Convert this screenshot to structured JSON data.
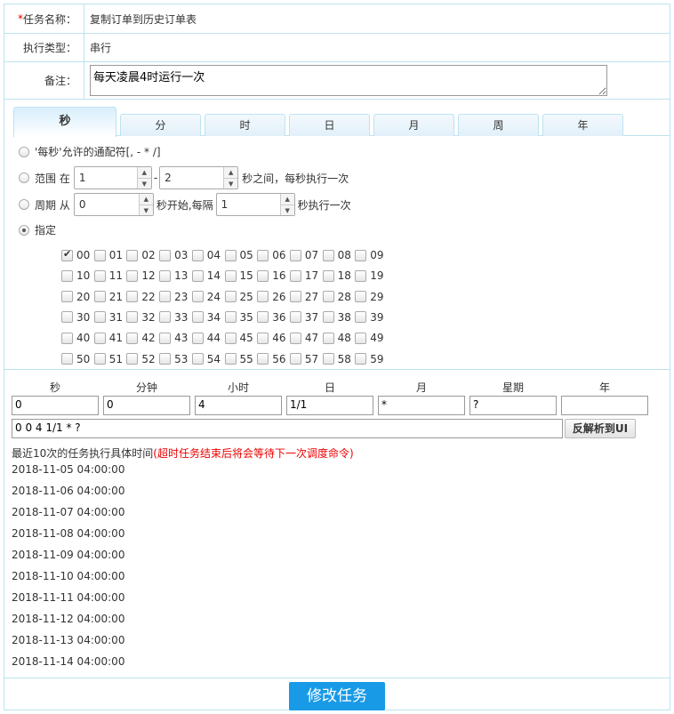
{
  "form": {
    "task_name_required_mark": "*",
    "task_name_label": "任务名称：",
    "task_name_value": "复制订单到历史订单表",
    "exec_type_label": "执行类型：",
    "exec_type_value": "串行",
    "note_label": "备注：",
    "note_value": "每天凌晨4时运行一次"
  },
  "tabs": [
    "秒",
    "分",
    "时",
    "日",
    "月",
    "周",
    "年"
  ],
  "active_tab": "秒",
  "seconds": {
    "opt_every": "'每秒'允许的通配符[, - * /]",
    "opt_range_prefix": "范围 在",
    "range_from": "1",
    "range_dash": "-",
    "range_to": "2",
    "opt_range_suffix": "秒之间，每秒执行一次",
    "opt_cycle_prefix": "周期 从",
    "cycle_start": "0",
    "cycle_mid": "秒开始,每隔",
    "cycle_step": "1",
    "cycle_suffix": "秒执行一次",
    "opt_specify": "指定",
    "selected_option": "指定",
    "checked_values": [
      "00"
    ],
    "values": [
      "00",
      "01",
      "02",
      "03",
      "04",
      "05",
      "06",
      "07",
      "08",
      "09",
      "10",
      "11",
      "12",
      "13",
      "14",
      "15",
      "16",
      "17",
      "18",
      "19",
      "20",
      "21",
      "22",
      "23",
      "24",
      "25",
      "26",
      "27",
      "28",
      "29",
      "30",
      "31",
      "32",
      "33",
      "34",
      "35",
      "36",
      "37",
      "38",
      "39",
      "40",
      "41",
      "42",
      "43",
      "44",
      "45",
      "46",
      "47",
      "48",
      "49",
      "50",
      "51",
      "52",
      "53",
      "54",
      "55",
      "56",
      "57",
      "58",
      "59"
    ]
  },
  "expression": {
    "headers": [
      "秒",
      "分钟",
      "小时",
      "日",
      "月",
      "星期",
      "年"
    ],
    "values": [
      "0",
      "0",
      "4",
      "1/1",
      "*",
      "?",
      ""
    ],
    "full": "0 0 4 1/1 * ?",
    "reverse_button": "反解析到UI"
  },
  "recent": {
    "title": "最近10次的任务执行具体时间",
    "note": "(超时任务结束后将会等待下一次调度命令)",
    "times": [
      "2018-11-05 04:00:00",
      "2018-11-06 04:00:00",
      "2018-11-07 04:00:00",
      "2018-11-08 04:00:00",
      "2018-11-09 04:00:00",
      "2018-11-10 04:00:00",
      "2018-11-11 04:00:00",
      "2018-11-12 04:00:00",
      "2018-11-13 04:00:00",
      "2018-11-14 04:00:00"
    ]
  },
  "submit_label": "修改任务",
  "colors": {
    "border": "#bde3f0",
    "button": "#199ae6",
    "required": "#dd0000",
    "note_red": "#ee0000"
  }
}
